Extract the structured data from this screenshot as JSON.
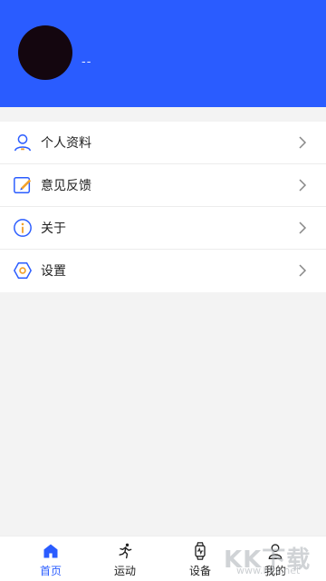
{
  "profile": {
    "username": "--"
  },
  "menu": {
    "items": [
      {
        "label": "个人资料",
        "icon": "user-icon"
      },
      {
        "label": "意见反馈",
        "icon": "edit-icon"
      },
      {
        "label": "关于",
        "icon": "info-icon"
      },
      {
        "label": "设置",
        "icon": "settings-icon"
      }
    ]
  },
  "bottom_nav": {
    "items": [
      {
        "label": "首页",
        "icon": "home-icon",
        "active": true
      },
      {
        "label": "运动",
        "icon": "running-icon",
        "active": false
      },
      {
        "label": "设备",
        "icon": "watch-icon",
        "active": false
      },
      {
        "label": "我的",
        "icon": "profile-icon",
        "active": false
      }
    ]
  },
  "watermark": {
    "text": "KK下载",
    "sub": "www.kkx.net"
  },
  "colors": {
    "header_bg": "#2a5cff",
    "accent": "#2a5cff",
    "edit_accent": "#f2a12a",
    "settings_accent": "#f2a12a"
  }
}
